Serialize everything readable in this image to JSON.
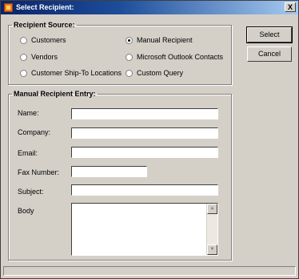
{
  "window": {
    "title": "Select Recipient:",
    "close_glyph": "X"
  },
  "recipient_source": {
    "legend": "Recipient Source:",
    "options": [
      {
        "label": "Customers",
        "checked": false
      },
      {
        "label": "Vendors",
        "checked": false
      },
      {
        "label": "Customer Ship-To Locations",
        "checked": false
      },
      {
        "label": "Manual Recipient",
        "checked": true
      },
      {
        "label": "Microsoft Outlook Contacts",
        "checked": false
      },
      {
        "label": "Custom Query",
        "checked": false
      }
    ]
  },
  "manual_entry": {
    "legend": "Manual Recipient Entry:",
    "labels": {
      "name": "Name:",
      "company": "Company:",
      "email": "Email:",
      "fax": "Fax Number:",
      "subject": "Subject:",
      "body": "Body"
    },
    "values": {
      "name": "",
      "company": "",
      "email": "",
      "fax": "",
      "subject": "",
      "body": ""
    }
  },
  "buttons": {
    "select": "Select",
    "cancel": "Cancel"
  },
  "icons": {
    "app": "app-icon",
    "scroll_up": "scroll-up-icon",
    "scroll_down": "scroll-down-icon"
  }
}
